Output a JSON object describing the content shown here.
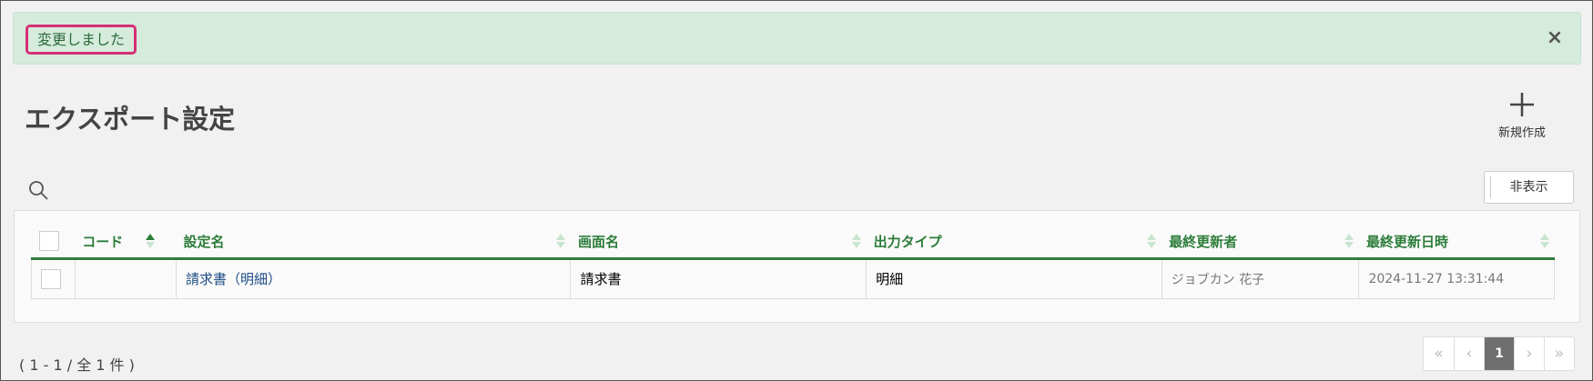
{
  "alert": {
    "message": "変更しました",
    "close": "×"
  },
  "page": {
    "title": "エクスポート設定"
  },
  "toolbar": {
    "new_label": "新規作成",
    "hide_label": "非表示"
  },
  "table": {
    "headers": [
      "コード",
      "設定名",
      "画面名",
      "出力タイプ",
      "最終更新者",
      "最終更新日時"
    ],
    "rows": [
      {
        "code": "",
        "name": "請求書（明細）",
        "screen": "請求書",
        "output_type": "明細",
        "updated_by": "ジョブカン 花子",
        "updated_at": "2024-11-27 13:31:44"
      }
    ]
  },
  "pagination": {
    "info": "( 1 - 1 / 全 1 件 )",
    "first": "«",
    "prev": "‹",
    "current": "1",
    "next": "›",
    "last": "»"
  }
}
